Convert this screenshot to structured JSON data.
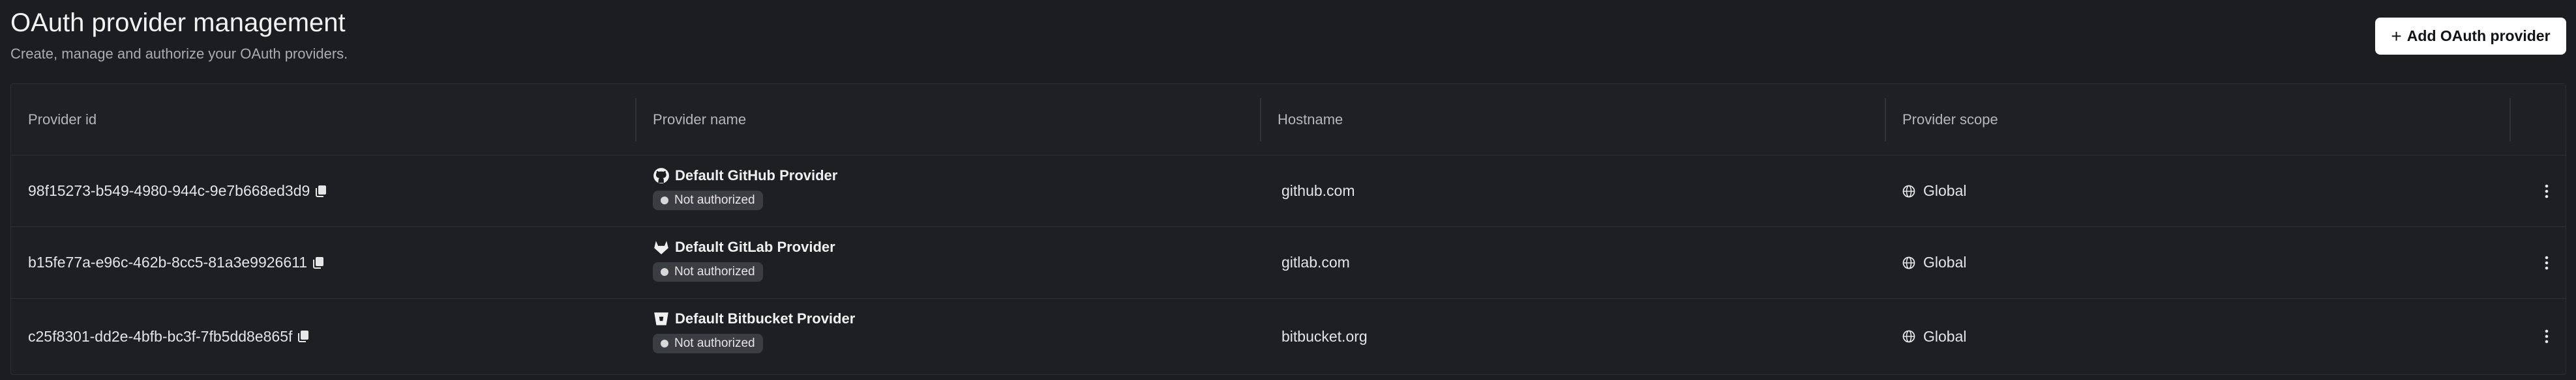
{
  "header": {
    "title": "OAuth provider management",
    "subtitle": "Create, manage and authorize your OAuth providers.",
    "add_button_label": "Add OAuth provider"
  },
  "table": {
    "columns": [
      "Provider id",
      "Provider name",
      "Hostname",
      "Provider scope"
    ],
    "rows": [
      {
        "id": "98f15273-b549-4980-944c-9e7b668ed3d9",
        "name": "Default GitHub Provider",
        "icon": "github-icon",
        "status": "Not authorized",
        "hostname": "github.com",
        "scope": "Global"
      },
      {
        "id": "b15fe77a-e96c-462b-8cc5-81a3e9926611",
        "name": "Default GitLab Provider",
        "icon": "gitlab-icon",
        "status": "Not authorized",
        "hostname": "gitlab.com",
        "scope": "Global"
      },
      {
        "id": "c25f8301-dd2e-4bfb-bc3f-7fb5dd8e865f",
        "name": "Default Bitbucket Provider",
        "icon": "bitbucket-icon",
        "status": "Not authorized",
        "hostname": "bitbucket.org",
        "scope": "Global"
      }
    ]
  },
  "colors": {
    "background": "#1b1d20",
    "badge_bg": "#3a3d42",
    "button_bg": "#ffffff"
  }
}
